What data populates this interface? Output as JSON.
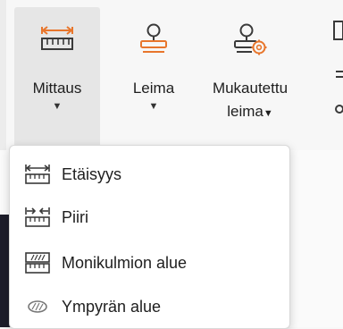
{
  "ribbon": {
    "measure": {
      "label": "Mittaus",
      "icon": "ruler-icon"
    },
    "stamp": {
      "label": "Leima",
      "icon": "stamp-icon"
    },
    "custom_stamp": {
      "label_line1": "Mukautettu",
      "label_line2": "leima",
      "icon": "custom-stamp-icon"
    }
  },
  "menu": {
    "items": [
      {
        "label": "Etäisyys",
        "icon": "distance-icon"
      },
      {
        "label": "Piiri",
        "icon": "perimeter-icon"
      },
      {
        "label": "Monikulmion alue",
        "icon": "polygon-area-icon"
      },
      {
        "label": "Ympyrän alue",
        "icon": "circle-area-icon"
      }
    ]
  },
  "colors": {
    "accent": "#e8762c",
    "ruler": "#3a3a3a",
    "ribbon_bg": "#f7f7f7",
    "selected_bg": "#e6e6e6"
  }
}
